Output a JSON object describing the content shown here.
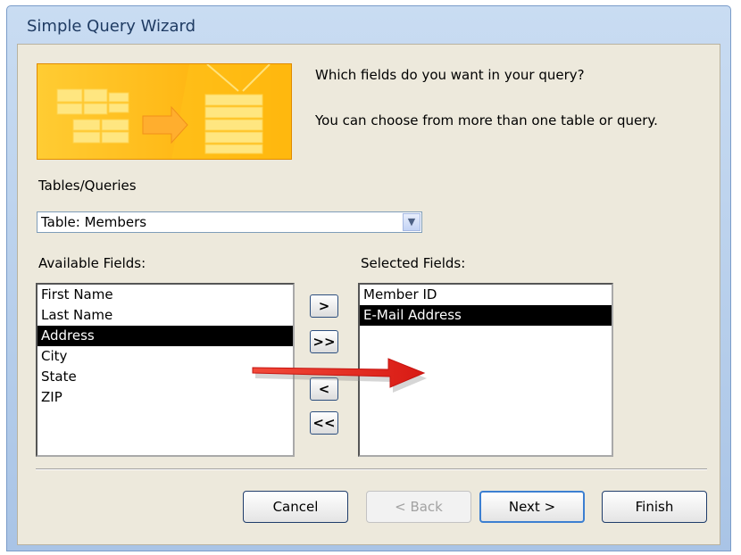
{
  "window": {
    "title": "Simple Query Wizard"
  },
  "intro": {
    "question": "Which fields do you want in your query?",
    "hint": "You can choose from more than one table or query."
  },
  "tables": {
    "label": "Tables/Queries",
    "value": "Table: Members"
  },
  "available": {
    "label": "Available Fields:",
    "items": [
      "First Name",
      "Last Name",
      "Address",
      "City",
      "State",
      "ZIP"
    ],
    "selected": "Address"
  },
  "selected_fields": {
    "label": "Selected Fields:",
    "items": [
      "Member ID",
      "E-Mail Address"
    ],
    "selected": "E-Mail Address"
  },
  "move_buttons": {
    "add_one": ">",
    "add_all": ">>",
    "remove_one": "<",
    "remove_all": "<<"
  },
  "buttons": {
    "cancel": "Cancel",
    "back": "< Back",
    "next": "Next >",
    "finish": "Finish"
  },
  "colors": {
    "annotation_arrow": "#e8201e",
    "banner": "#ffb300",
    "selection": "#000000"
  }
}
